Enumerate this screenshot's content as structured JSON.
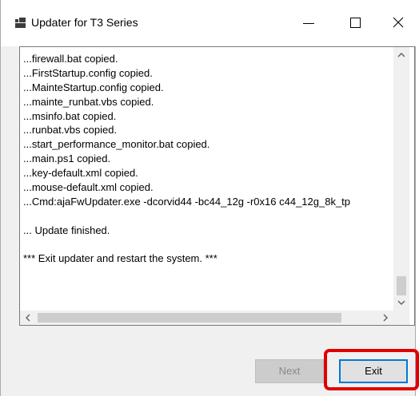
{
  "window": {
    "title": "Updater for T3 Series"
  },
  "log": {
    "lines": [
      "...firewall.bat copied.",
      "...FirstStartup.config copied.",
      "...MainteStartup.config copied.",
      "...mainte_runbat.vbs copied.",
      "...msinfo.bat copied.",
      "...runbat.vbs copied.",
      "...start_performance_monitor.bat copied.",
      "...main.ps1 copied.",
      "...key-default.xml copied.",
      "...mouse-default.xml copied.",
      "...Cmd:ajaFwUpdater.exe -dcorvid44 -bc44_12g -r0x16 c44_12g_8k_tp",
      "",
      "... Update finished.",
      "",
      "*** Exit updater and restart the system. ***"
    ]
  },
  "buttons": {
    "next_label": "Next",
    "exit_label": "Exit"
  },
  "colors": {
    "highlight": "#e00000",
    "exit_border": "#0078d7"
  }
}
